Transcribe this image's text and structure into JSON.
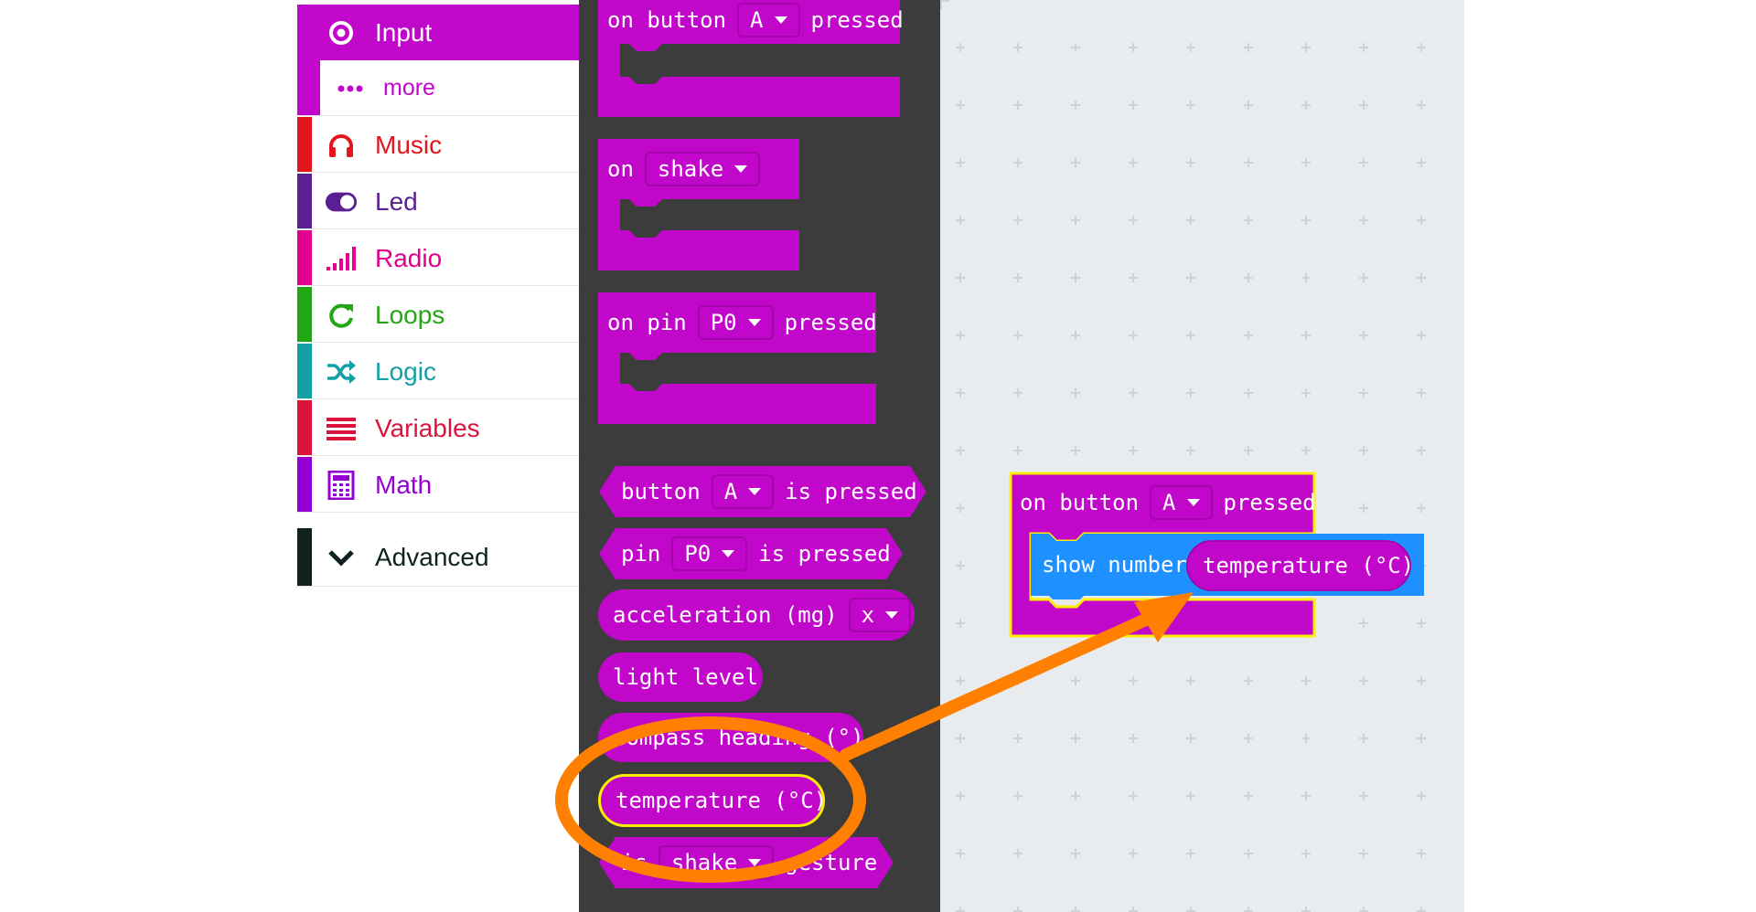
{
  "sidebar": {
    "items": [
      {
        "label": "Input",
        "icon": "target-icon",
        "color": "#c107ca",
        "active": true
      },
      {
        "label": "more",
        "icon": "more-dots-icon",
        "color": "#c107ca"
      },
      {
        "label": "Music",
        "icon": "headphones-icon",
        "color": "#e4161d"
      },
      {
        "label": "Led",
        "icon": "toggle-icon",
        "color": "#5b1f94"
      },
      {
        "label": "Radio",
        "icon": "signal-bars-icon",
        "color": "#e3008c"
      },
      {
        "label": "Loops",
        "icon": "refresh-icon",
        "color": "#22a613"
      },
      {
        "label": "Logic",
        "icon": "shuffle-icon",
        "color": "#13a0a4"
      },
      {
        "label": "Variables",
        "icon": "list-icon",
        "color": "#dc143c"
      },
      {
        "label": "Math",
        "icon": "calculator-icon",
        "color": "#9400d3"
      },
      {
        "label": "Advanced",
        "icon": "chevron-down-icon",
        "color": "#0e2220"
      }
    ]
  },
  "flyout": {
    "on_button": {
      "prefix": "on button",
      "value": "A",
      "suffix": "pressed"
    },
    "on_shake": {
      "prefix": "on",
      "value": "shake"
    },
    "on_pin": {
      "prefix": "on pin",
      "value": "P0",
      "suffix": "pressed"
    },
    "button_is_pressed": {
      "prefix": "button",
      "value": "A",
      "suffix": "is pressed"
    },
    "pin_is_pressed": {
      "prefix": "pin",
      "value": "P0",
      "suffix": "is pressed"
    },
    "acceleration": {
      "prefix": "acceleration (mg)",
      "value": "x"
    },
    "light_level": "light level",
    "compass_heading": "compass heading (°)",
    "temperature": "temperature (°C)",
    "is_gesture": {
      "prefix": "is",
      "value": "shake",
      "suffix": "gesture"
    }
  },
  "workspace": {
    "event": {
      "prefix": "on button",
      "value": "A",
      "suffix": "pressed"
    },
    "show_number": "show number",
    "temperature": "temperature (°C)"
  },
  "colors": {
    "input": "#c107ca",
    "basic": "#1e90ff",
    "highlight": "#ffee00",
    "annotation": "#ff7f00",
    "flyout_bg": "#3c3c3c",
    "workspace_bg": "#e9ecef"
  }
}
